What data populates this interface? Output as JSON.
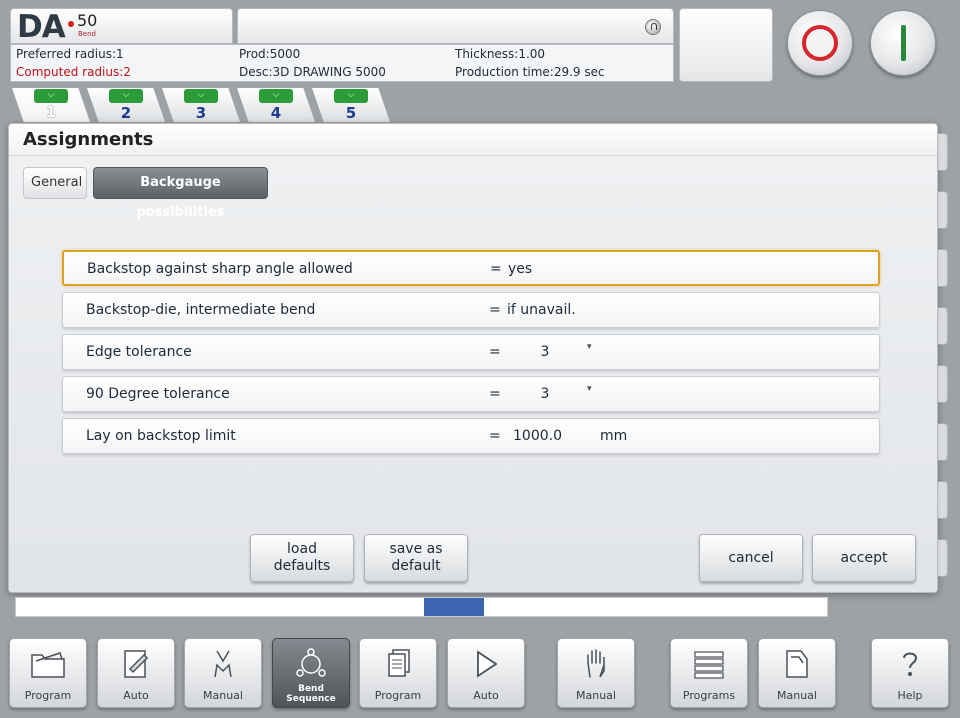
{
  "header": {
    "logo": {
      "brand": "DA",
      "model": "50",
      "sub": "Bend"
    },
    "info": {
      "preferred_radius": "Preferred radius:1",
      "computed_radius": "Computed radius:2",
      "prod": "Prod:5000",
      "desc": "Desc:3D DRAWING 5000",
      "thickness": "Thickness:1.00",
      "production_time": "Production time:29.9 sec"
    }
  },
  "step_tabs": [
    {
      "label": "1",
      "icon": "bend-step-icon",
      "active": true
    },
    {
      "label": "2",
      "icon": "bend-step-icon"
    },
    {
      "label": "3",
      "icon": "bend-step-icon"
    },
    {
      "label": "4",
      "icon": "bend-step-icon"
    },
    {
      "label": "5",
      "icon": "bend-step-icon"
    }
  ],
  "dialog": {
    "title": "Assignments",
    "tabs": {
      "general": "General",
      "backgauge": "Backgauge possibilities"
    },
    "params": [
      {
        "label": "Backstop against sharp angle allowed",
        "eq": "=",
        "value": "yes"
      },
      {
        "label": "Backstop-die, intermediate bend",
        "eq": "=",
        "value": "if unavail."
      },
      {
        "label": "Edge tolerance",
        "eq": "=",
        "value": "3"
      },
      {
        "label": "90 Degree tolerance",
        "eq": "=",
        "value": "3"
      },
      {
        "label": "Lay on backstop limit",
        "eq": "=",
        "value": "1000.0",
        "unit": "mm"
      }
    ],
    "buttons": {
      "load_defaults": [
        "load",
        "defaults"
      ],
      "save_as_default": [
        "save as",
        "default"
      ],
      "cancel": "cancel",
      "accept": "accept"
    }
  },
  "progress": {
    "marker_position": 0.5
  },
  "nav": [
    {
      "label": "Program",
      "icon": "folder-icon"
    },
    {
      "label": "Auto",
      "icon": "edit-icon"
    },
    {
      "label": "Manual",
      "icon": "bend-tool-icon"
    },
    {
      "label": "Bend Sequence",
      "icon": "bend-sequence-icon",
      "active": true
    },
    {
      "label": "Program",
      "icon": "pages-icon"
    },
    {
      "label": "Auto",
      "icon": "play-icon"
    },
    {
      "label": "Manual",
      "icon": "hand-icon"
    },
    {
      "label": "Programs",
      "icon": "list-icon"
    },
    {
      "label": "Manual",
      "icon": "drawer-icon"
    },
    {
      "label": "Help",
      "icon": "question-icon"
    }
  ],
  "colors": {
    "accent_blue": "#3c66b0",
    "selection_orange": "#e0a028",
    "stop_red": "#d8262c",
    "start_green": "#2a8a3a",
    "warning_red": "#c1141a"
  }
}
